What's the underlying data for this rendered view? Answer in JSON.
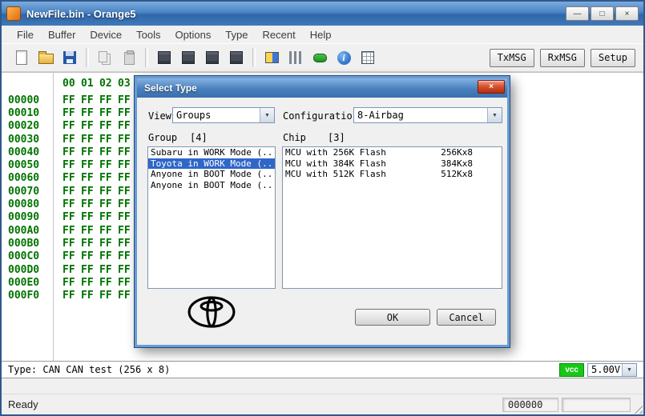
{
  "window": {
    "title": "NewFile.bin - Orange5",
    "controls": [
      {
        "name": "minimize",
        "glyph": "—"
      },
      {
        "name": "maximize",
        "glyph": "□"
      },
      {
        "name": "close",
        "glyph": "×"
      }
    ]
  },
  "glyphs": {
    "dropdown": "▼",
    "close": "×"
  },
  "menu": {
    "items": [
      "File",
      "Buffer",
      "Device",
      "Tools",
      "Options",
      "Type",
      "Recent",
      "Help"
    ]
  },
  "toolbar": {
    "icons": [
      "new-file-icon",
      "open-file-icon",
      "save-file-icon",
      "sep",
      "copy-icon",
      "paste-icon",
      "sep",
      "buffer-1-icon",
      "buffer-2-icon",
      "buffer-3-icon",
      "buffer-4-icon",
      "sep",
      "swap-buffers-icon",
      "signal-icon",
      "connect-device-icon",
      "info-icon",
      "checksum-icon"
    ],
    "txmsg_label": "TxMSG",
    "rxmsg_label": "RxMSG",
    "setup_label": "Setup"
  },
  "hex_editor": {
    "column_headers": [
      "00",
      "01",
      "02",
      "03"
    ],
    "rows": [
      {
        "address": "00000",
        "values": [
          "FF",
          "FF",
          "FF",
          "FF"
        ]
      },
      {
        "address": "00010",
        "values": [
          "FF",
          "FF",
          "FF",
          "FF"
        ]
      },
      {
        "address": "00020",
        "values": [
          "FF",
          "FF",
          "FF",
          "FF"
        ]
      },
      {
        "address": "00030",
        "values": [
          "FF",
          "FF",
          "FF",
          "FF"
        ]
      },
      {
        "address": "00040",
        "values": [
          "FF",
          "FF",
          "FF",
          "FF"
        ]
      },
      {
        "address": "00050",
        "values": [
          "FF",
          "FF",
          "FF",
          "FF"
        ]
      },
      {
        "address": "00060",
        "values": [
          "FF",
          "FF",
          "FF",
          "FF"
        ]
      },
      {
        "address": "00070",
        "values": [
          "FF",
          "FF",
          "FF",
          "FF"
        ]
      },
      {
        "address": "00080",
        "values": [
          "FF",
          "FF",
          "FF",
          "FF"
        ]
      },
      {
        "address": "00090",
        "values": [
          "FF",
          "FF",
          "FF",
          "FF"
        ]
      },
      {
        "address": "000A0",
        "values": [
          "FF",
          "FF",
          "FF",
          "FF"
        ]
      },
      {
        "address": "000B0",
        "values": [
          "FF",
          "FF",
          "FF",
          "FF"
        ]
      },
      {
        "address": "000C0",
        "values": [
          "FF",
          "FF",
          "FF",
          "FF"
        ]
      },
      {
        "address": "000D0",
        "values": [
          "FF",
          "FF",
          "FF",
          "FF"
        ]
      },
      {
        "address": "000E0",
        "values": [
          "FF",
          "FF",
          "FF",
          "FF"
        ]
      },
      {
        "address": "000F0",
        "values": [
          "FF",
          "FF",
          "FF",
          "FF"
        ]
      }
    ]
  },
  "dialog": {
    "title": "Select Type",
    "view_label": "View",
    "view_value": "Groups",
    "config_label": "Configuratio",
    "config_value": "8-Airbag",
    "group_label": "Group",
    "group_count": "[4]",
    "chip_label": "Chip",
    "chip_count": "[3]",
    "groups": [
      "Subaru in WORK Mode (..",
      "Toyota in WORK Mode (..",
      "Anyone in BOOT Mode (..",
      "Anyone in BOOT Mode (.."
    ],
    "selected_group_index": 1,
    "chips": [
      {
        "name": "MCU with 256K Flash",
        "size": "256Kx8"
      },
      {
        "name": "MCU with 384K Flash",
        "size": "384Kx8"
      },
      {
        "name": "MCU with 512K Flash",
        "size": "512Kx8"
      }
    ],
    "ok_label": "OK",
    "cancel_label": "Cancel"
  },
  "status": {
    "type_text": "Type: CAN CAN test (256 x 8)",
    "vcc_label": "vcc",
    "voltage_value": "5.00V",
    "ready_text": "Ready",
    "counter": "000000"
  }
}
